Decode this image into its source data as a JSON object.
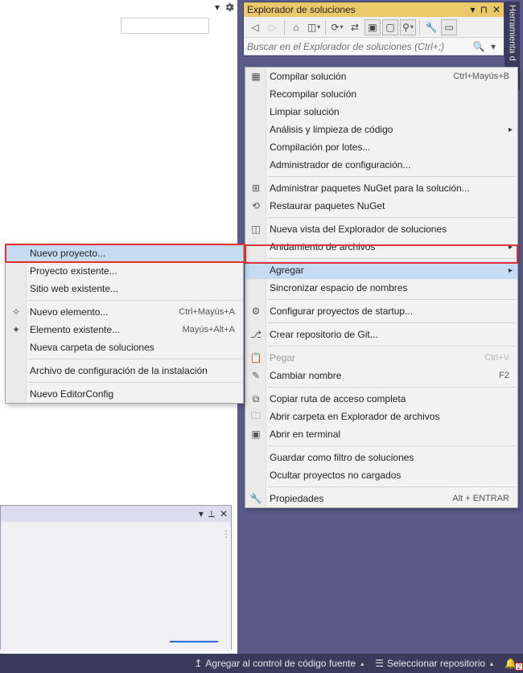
{
  "panels": {
    "solutionExplorer": {
      "title": "Explorador de soluciones",
      "searchPlaceholder": "Buscar en el Explorador de soluciones (Ctrl+;)"
    },
    "sideTab": "Herramienta d"
  },
  "contextMenu": {
    "items": [
      {
        "label": "Compilar solución",
        "shortcut": "Ctrl+Mayús+B",
        "icon": "build"
      },
      {
        "label": "Recompilar solución"
      },
      {
        "label": "Limpiar solución"
      },
      {
        "label": "Análisis y limpieza de código",
        "submenu": true
      },
      {
        "label": "Compilación por lotes..."
      },
      {
        "label": "Administrador de configuración..."
      },
      {
        "label": "Administrar paquetes NuGet para la solución...",
        "icon": "nuget"
      },
      {
        "label": "Restaurar paquetes NuGet",
        "icon": "restore"
      },
      {
        "label": "Nueva vista del Explorador de soluciones",
        "icon": "newview"
      },
      {
        "label": "Anidamiento de archivos",
        "submenu": true
      },
      {
        "label": "Agregar",
        "submenu": true,
        "highlight": true
      },
      {
        "label": "Sincronizar espacio de nombres"
      },
      {
        "label": "Configurar proyectos de startup...",
        "icon": "gear"
      },
      {
        "label": "Crear repositorio de Git...",
        "icon": "git"
      },
      {
        "label": "Pegar",
        "shortcut": "Ctrl+V",
        "icon": "paste",
        "disabled": true
      },
      {
        "label": "Cambiar nombre",
        "shortcut": "F2",
        "icon": "rename"
      },
      {
        "label": "Copiar ruta de acceso completa",
        "icon": "copy"
      },
      {
        "label": "Abrir carpeta en Explorador de archivos",
        "icon": "folder"
      },
      {
        "label": "Abrir en terminal",
        "icon": "terminal"
      },
      {
        "label": "Guardar como filtro de soluciones"
      },
      {
        "label": "Ocultar proyectos no cargados"
      },
      {
        "label": "Propiedades",
        "shortcut": "Alt + ENTRAR",
        "icon": "wrench"
      }
    ]
  },
  "submenu": {
    "items": [
      {
        "label": "Nuevo proyecto...",
        "highlight": true
      },
      {
        "label": "Proyecto existente..."
      },
      {
        "label": "Sitio web existente..."
      },
      {
        "label": "Nuevo elemento...",
        "shortcut": "Ctrl+Mayús+A",
        "icon": "newitem"
      },
      {
        "label": "Elemento existente...",
        "shortcut": "Mayús+Alt+A",
        "icon": "existitem"
      },
      {
        "label": "Nueva carpeta de soluciones"
      },
      {
        "label": "Archivo de configuración de la instalación"
      },
      {
        "label": "Nuevo EditorConfig"
      }
    ]
  },
  "statusbar": {
    "addSource": "Agregar al control de código fuente",
    "selectRepo": "Seleccionar repositorio",
    "notifications": "2"
  }
}
